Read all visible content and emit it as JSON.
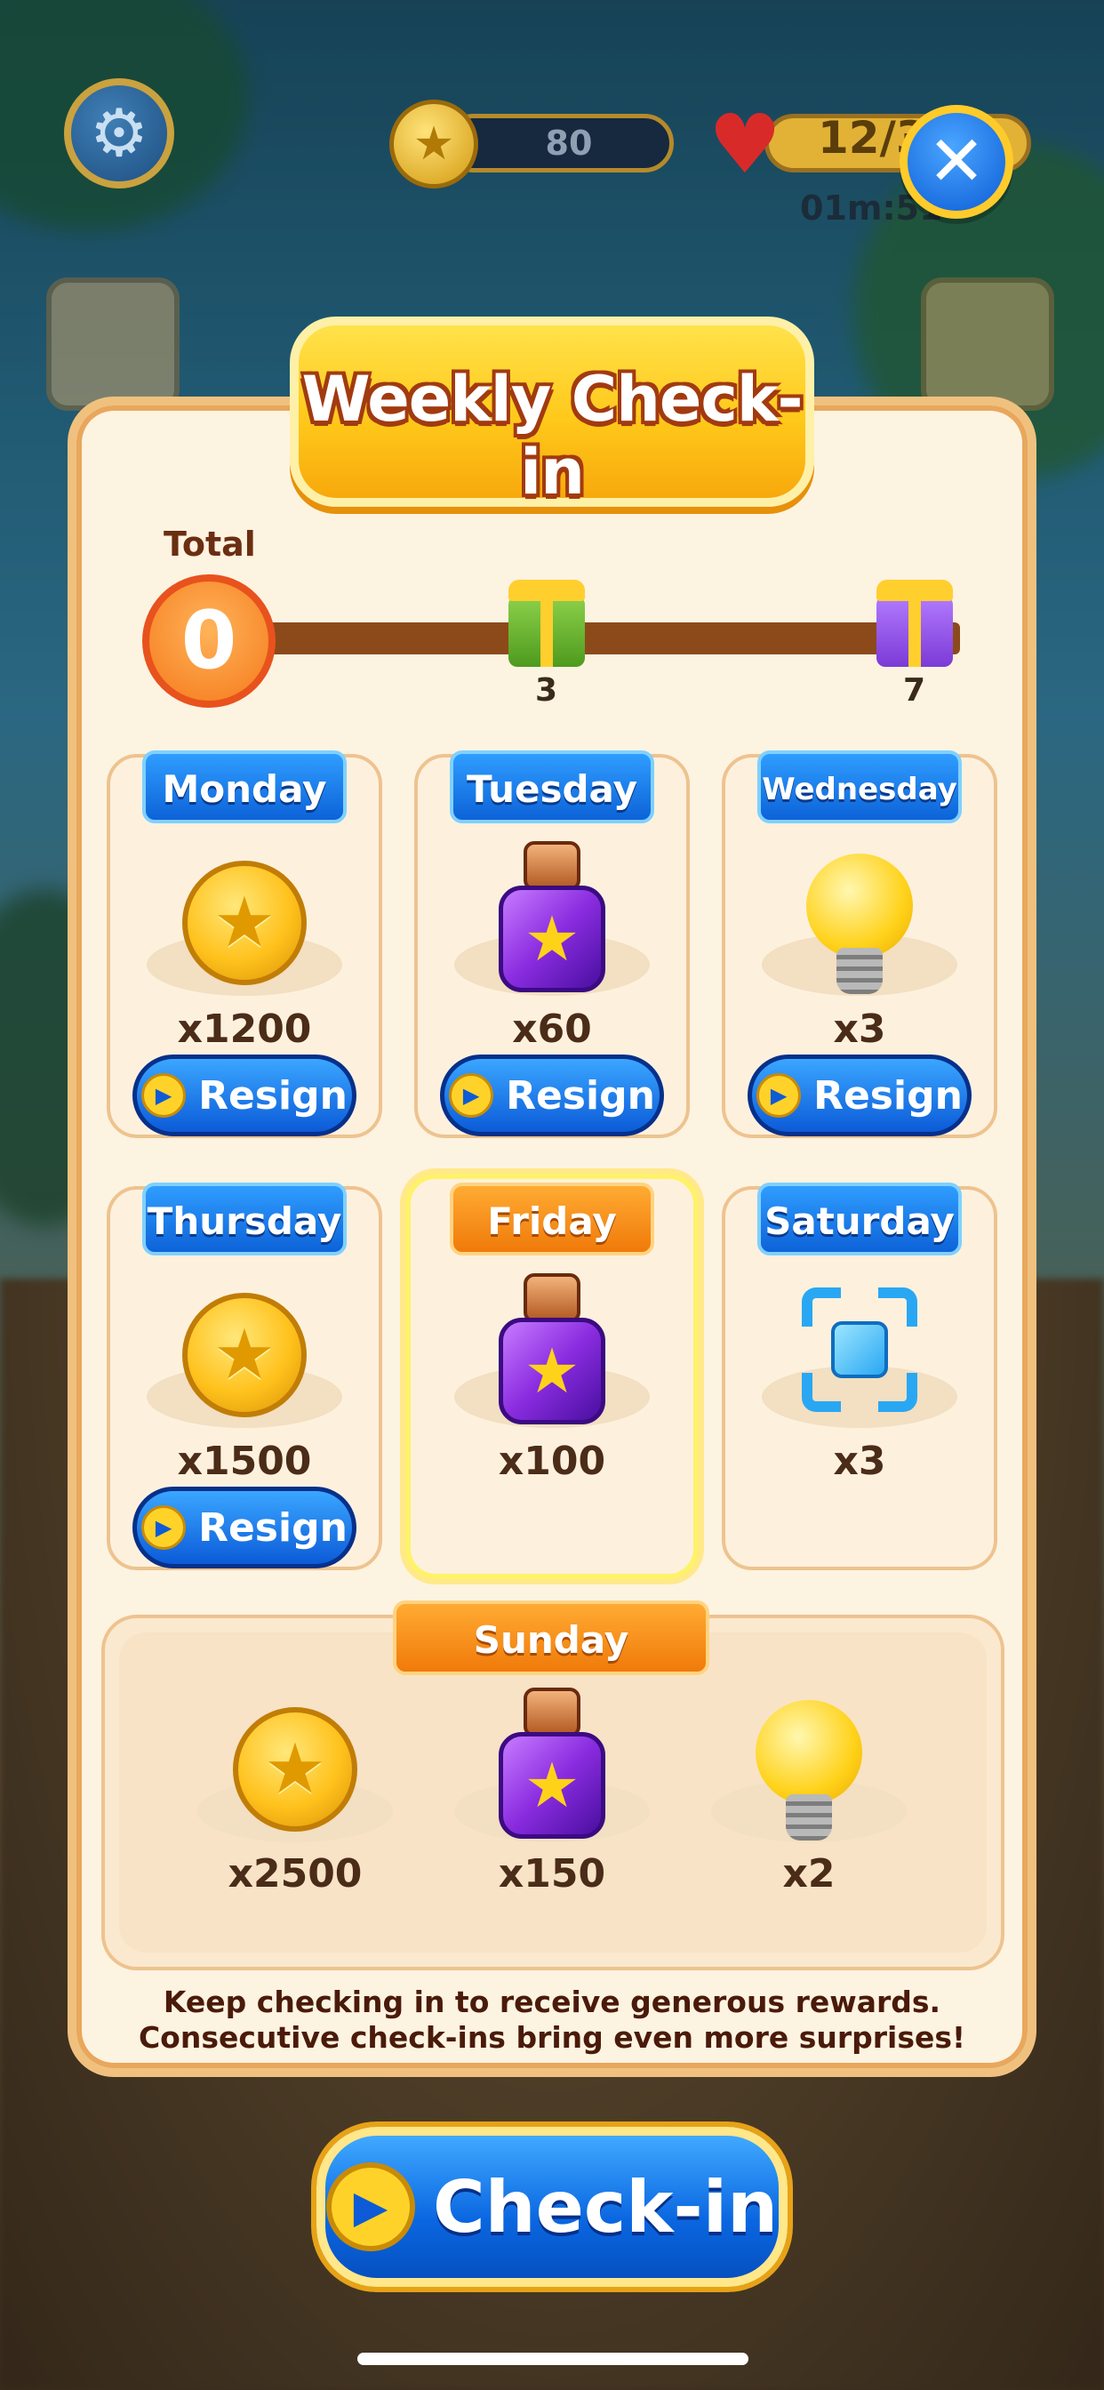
{
  "hud": {
    "coins": "80",
    "lives": "12/3",
    "timer": "01m:51"
  },
  "title": "Weekly Check-in",
  "progress": {
    "total_label": "Total",
    "total_value": "0",
    "milestones": [
      "3",
      "7"
    ]
  },
  "days": [
    {
      "day": "Monday",
      "reward_icon": "coin-icon",
      "amount": "x1200",
      "button": "Resign"
    },
    {
      "day": "Tuesday",
      "reward_icon": "potion-icon",
      "amount": "x60",
      "button": "Resign"
    },
    {
      "day": "Wednesday",
      "reward_icon": "lightbulb-icon",
      "amount": "x3",
      "button": "Resign"
    },
    {
      "day": "Thursday",
      "reward_icon": "coin-icon",
      "amount": "x1500",
      "button": "Resign"
    },
    {
      "day": "Friday",
      "reward_icon": "potion-icon",
      "amount": "x100"
    },
    {
      "day": "Saturday",
      "reward_icon": "frame-icon",
      "amount": "x3"
    }
  ],
  "sunday": {
    "day": "Sunday",
    "rewards": [
      {
        "reward_icon": "coin-icon",
        "amount": "x2500"
      },
      {
        "reward_icon": "potion-icon",
        "amount": "x150"
      },
      {
        "reward_icon": "lightbulb-icon",
        "amount": "x2"
      }
    ]
  },
  "footer": "Keep checking in to receive generous rewards. Consecutive check-ins bring even more surprises!",
  "checkin_button": "Check-in",
  "colors": {
    "panel": "#fdf3e1",
    "title_tab": "#ffc81a",
    "day_label_blue": "#1a7fe8",
    "day_label_orange": "#f5901a",
    "button_blue": "#0c5bd8"
  }
}
